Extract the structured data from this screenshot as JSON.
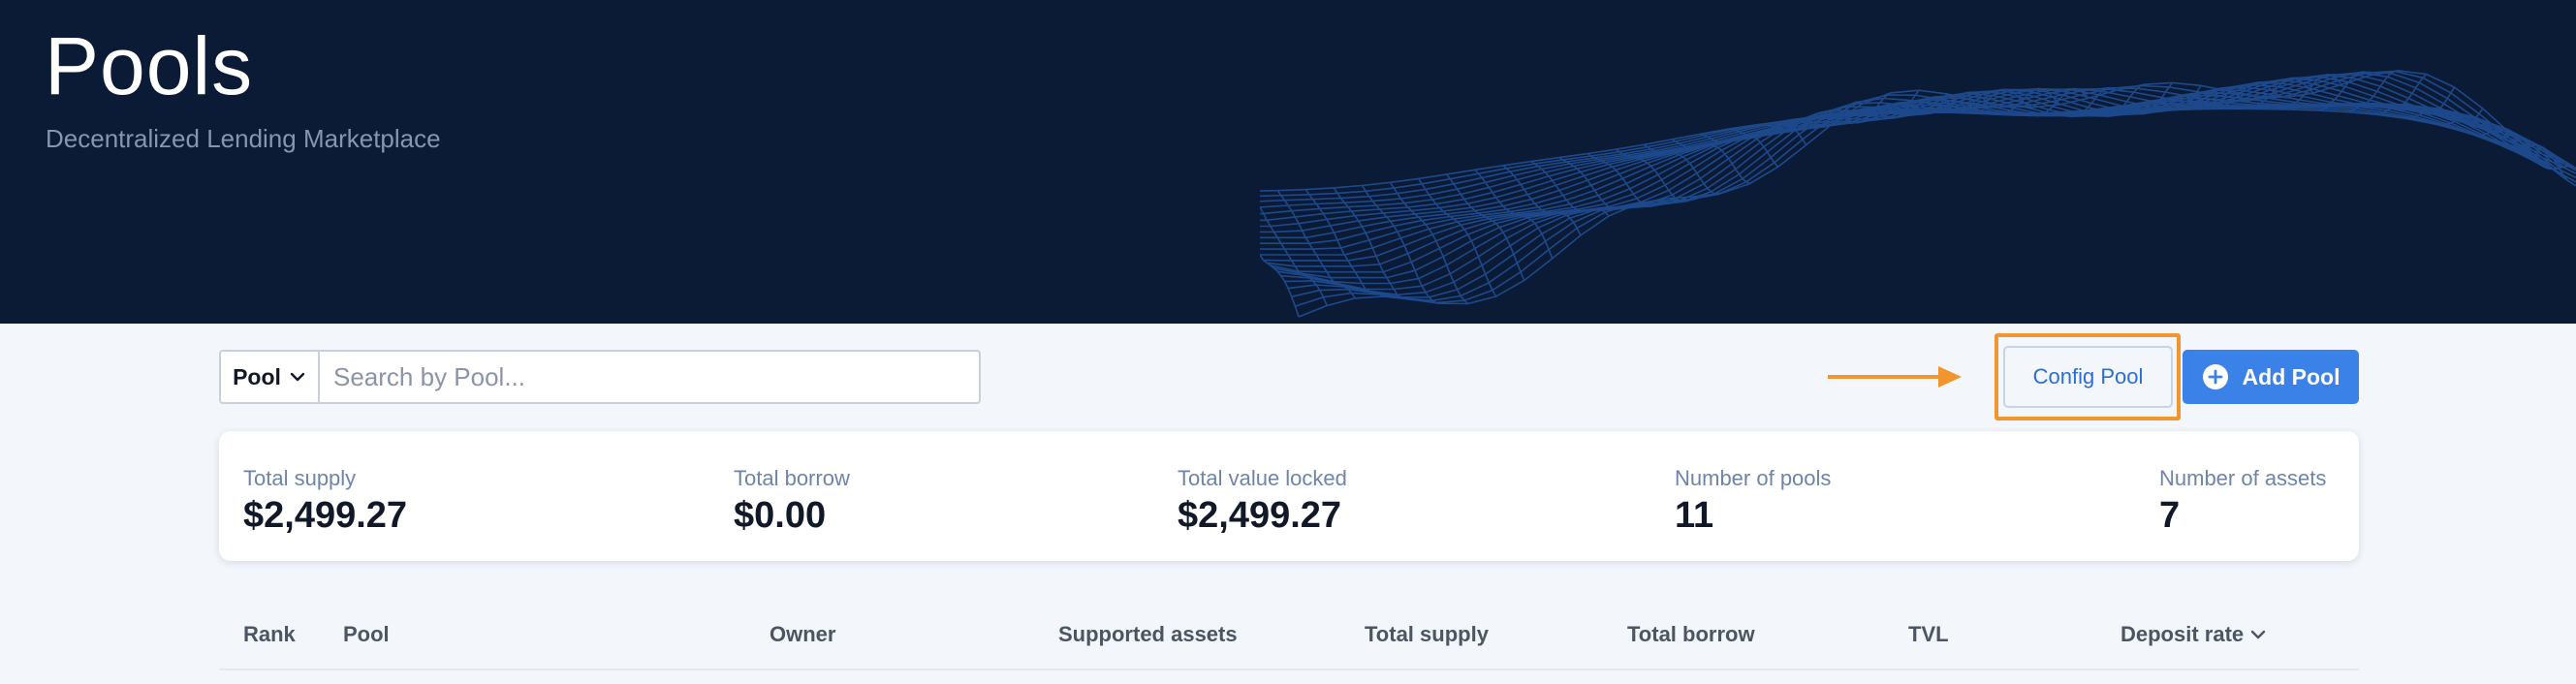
{
  "header": {
    "title": "Pools",
    "subtitle": "Decentralized Lending Marketplace"
  },
  "toolbar": {
    "filter_select": "Pool",
    "search_placeholder": "Search by Pool...",
    "config_label": "Config Pool",
    "add_label": "Add Pool"
  },
  "stats": [
    {
      "label": "Total supply",
      "value": "$2,499.27"
    },
    {
      "label": "Total borrow",
      "value": "$0.00"
    },
    {
      "label": "Total value locked",
      "value": "$2,499.27"
    },
    {
      "label": "Number of pools",
      "value": "11"
    },
    {
      "label": "Number of assets",
      "value": "7"
    }
  ],
  "table": {
    "columns": [
      "Rank",
      "Pool",
      "Owner",
      "Supported assets",
      "Total supply",
      "Total borrow",
      "TVL",
      "Deposit rate"
    ],
    "sort_column": "Deposit rate"
  },
  "colors": {
    "header_bg": "#0b1a35",
    "accent": "#3b82e8",
    "highlight": "#f0952f"
  },
  "icons": [
    "chevron-down-icon",
    "plus-circle-icon",
    "arrow-right-icon",
    "sort-chevron-icon"
  ]
}
